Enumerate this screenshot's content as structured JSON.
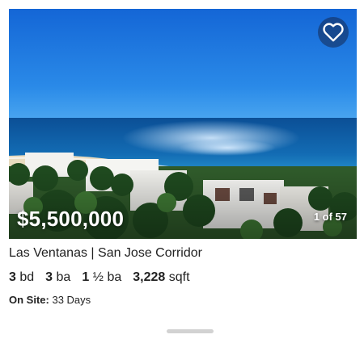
{
  "listing": {
    "price": "$5,500,000",
    "photo_counter": "1 of 57",
    "address": "Las Ventanas | San Jose Corridor",
    "beds_value": "3",
    "beds_unit": "bd",
    "baths_value": "3",
    "baths_unit": "ba",
    "half_baths_value": "1",
    "half_baths_unit": "½ ba",
    "sqft_value": "3,228",
    "sqft_unit": "sqft",
    "on_site_label": "On Site:",
    "on_site_value": "33 Days"
  },
  "icons": {
    "favorite": "heart-icon"
  },
  "colors": {
    "sky": "#1a73d8",
    "ocean": "#0d5fa8",
    "price_text": "#ffffff"
  }
}
